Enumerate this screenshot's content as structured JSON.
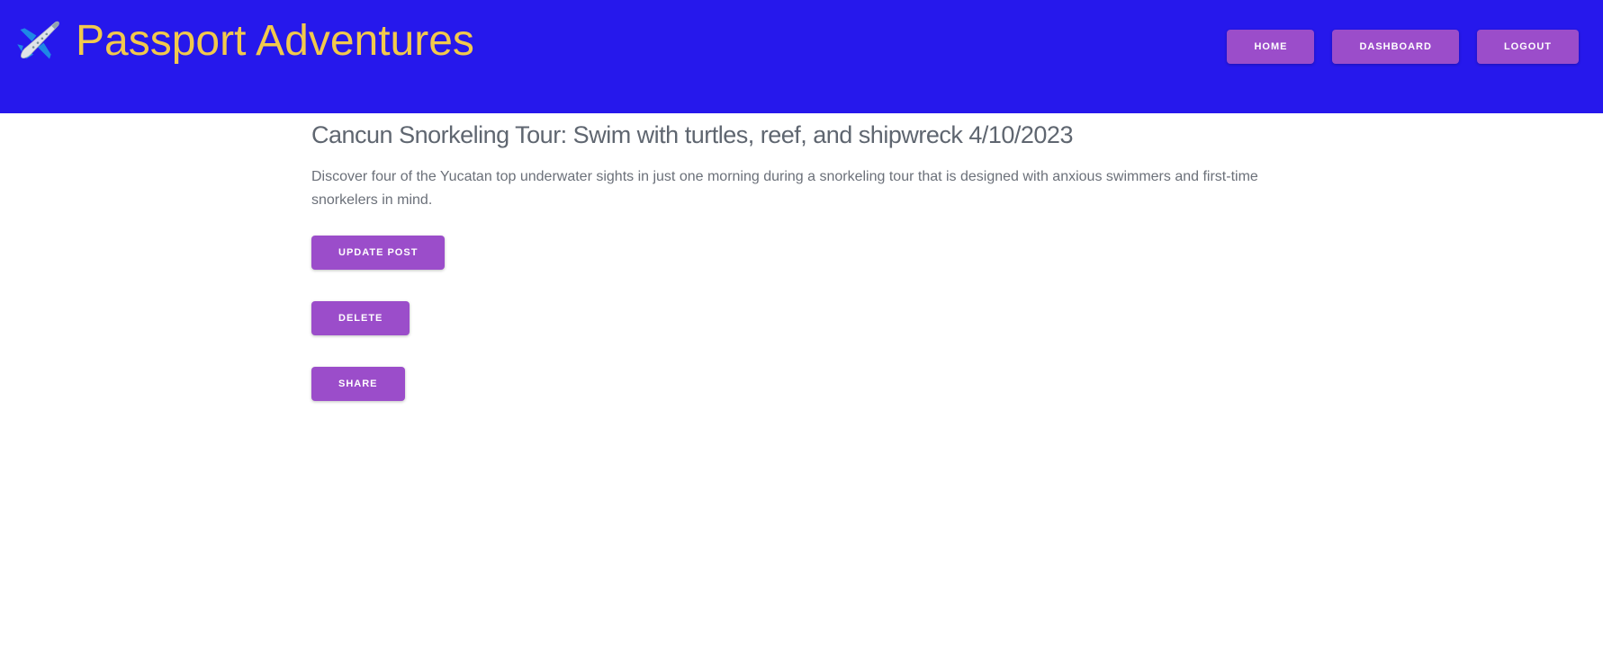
{
  "header": {
    "brand_icon": "airplane-icon",
    "brand_title": "Passport Adventures",
    "background": "#2618ec",
    "title_color": "#f2c94c"
  },
  "nav": {
    "home_label": "HOME",
    "dashboard_label": "DASHBOARD",
    "logout_label": "LOGOUT"
  },
  "post": {
    "title": "Cancun Snorkeling Tour: Swim with turtles, reef, and shipwreck 4/10/2023",
    "body": "Discover four of the Yucatan top underwater sights in just one morning during a snorkeling tour that is designed with anxious swimmers and first-time snorkelers in mind."
  },
  "actions": {
    "update_label": "UPDATE POST",
    "delete_label": "DELETE",
    "share_label": "SHARE"
  },
  "colors": {
    "button": "#9b4dca",
    "button_text": "#ffffff"
  }
}
